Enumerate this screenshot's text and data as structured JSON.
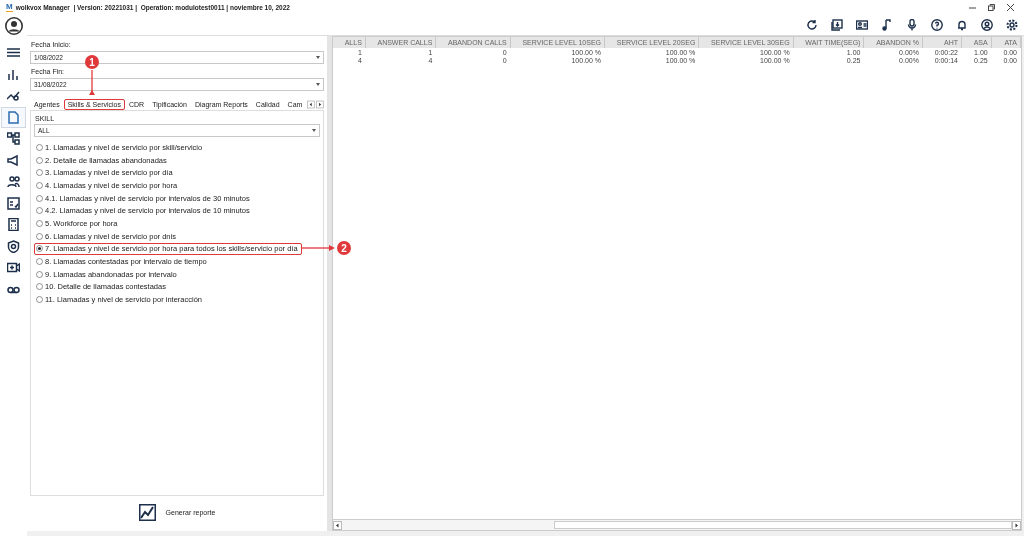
{
  "window": {
    "logo": "M",
    "title": "wolkvox Manager  | Version: 20221031 |  Operation: modulotest0011 | noviembre 10, 2022"
  },
  "sidebar": {
    "items": [
      {
        "selected": false
      },
      {
        "selected": false
      },
      {
        "selected": false
      },
      {
        "selected": true
      },
      {
        "selected": false
      },
      {
        "selected": false
      },
      {
        "selected": false
      },
      {
        "selected": false
      },
      {
        "selected": false
      },
      {
        "selected": false
      },
      {
        "selected": false
      },
      {
        "selected": false
      }
    ]
  },
  "filters": {
    "start_label": "Fecha Inicio:",
    "start_value": "1/08/2022",
    "end_label": "Fecha Fin:",
    "end_value": "31/08/2022"
  },
  "tabs": [
    {
      "label": "Agentes",
      "highlighted": false
    },
    {
      "label": "Skills & Servicios",
      "highlighted": true
    },
    {
      "label": "CDR",
      "highlighted": false
    },
    {
      "label": "Tipificación",
      "highlighted": false
    },
    {
      "label": "Diagram Reports",
      "highlighted": false
    },
    {
      "label": "Calidad",
      "highlighted": false
    },
    {
      "label": "Cam",
      "highlighted": false
    }
  ],
  "skill": {
    "label": "SKILL",
    "value": "ALL"
  },
  "reports": [
    {
      "label": "1. Llamadas y nivel de servicio por skill/servicio",
      "selected": false,
      "highlighted": false
    },
    {
      "label": "2. Detalle de llamadas abandonadas",
      "selected": false,
      "highlighted": false
    },
    {
      "label": "3. Llamadas y nivel de servicio por día",
      "selected": false,
      "highlighted": false
    },
    {
      "label": "4. Llamadas y nivel de servicio por hora",
      "selected": false,
      "highlighted": false
    },
    {
      "label": "4.1. Llamadas y nivel de servicio por intervalos de 30 minutos",
      "selected": false,
      "highlighted": false
    },
    {
      "label": "4.2. Llamadas y nivel de servicio por intervalos de 10 minutos",
      "selected": false,
      "highlighted": false
    },
    {
      "label": "5. Workforce por hora",
      "selected": false,
      "highlighted": false
    },
    {
      "label": "6. Llamadas y nivel de servicio por dnis",
      "selected": false,
      "highlighted": false
    },
    {
      "label": "7. Llamadas y nivel de servicio por hora para todos los skills/servicio por día",
      "selected": true,
      "highlighted": true
    },
    {
      "label": "8. Llamadas contestadas por intervalo de tiempo",
      "selected": false,
      "highlighted": false
    },
    {
      "label": "9. Llamadas abandonadas por intervalo",
      "selected": false,
      "highlighted": false
    },
    {
      "label": "10. Detalle de llamadas contestadas",
      "selected": false,
      "highlighted": false
    },
    {
      "label": "11. Llamadas y nivel de servicio por interacción",
      "selected": false,
      "highlighted": false
    }
  ],
  "generate_button": "Generar reporte",
  "table": {
    "columns": [
      "ALLS",
      "ANSWER CALLS",
      "ABANDON CALLS",
      "SERVICE LEVEL 10SEG",
      "SERVICE LEVEL 20SEG",
      "SERVICE LEVEL 30SEG",
      "WAIT TIME(SEG)",
      "ABANDON %",
      "AHT",
      "ASA",
      "ATA"
    ],
    "rows": [
      [
        "1",
        "1",
        "0",
        "100.00 %",
        "100.00 %",
        "100.00 %",
        "1.00",
        "0.00%",
        "0:00:22",
        "1.00",
        "0.00"
      ],
      [
        "4",
        "4",
        "0",
        "100.00 %",
        "100.00 %",
        "100.00 %",
        "0.25",
        "0.00%",
        "0:00:14",
        "0.25",
        "0.00"
      ]
    ]
  },
  "annotations": [
    {
      "number": "1"
    },
    {
      "number": "2"
    }
  ]
}
